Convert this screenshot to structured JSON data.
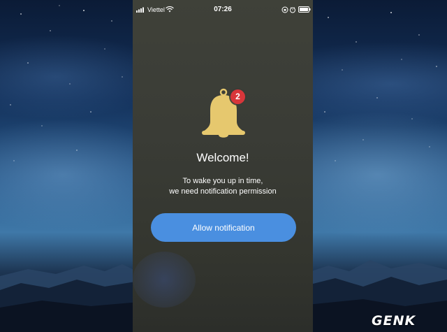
{
  "status_bar": {
    "carrier": "Viettel",
    "time": "07:26",
    "icons": [
      "signal-icon",
      "wifi-icon",
      "rotation-lock-icon",
      "alarm-icon",
      "battery-icon"
    ]
  },
  "onboarding": {
    "icon": "bell-icon",
    "badge_count": "2",
    "title": "Welcome!",
    "message_lines": [
      "To wake you up in time,",
      "we need notification permission"
    ],
    "allow_button_label": "Allow notification"
  },
  "watermark": {
    "text": "GENK"
  },
  "colors": {
    "accent": "#4a8fe0",
    "badge": "#d8363a",
    "bell": "#e6c86e",
    "overlay": "#3a3c36"
  }
}
